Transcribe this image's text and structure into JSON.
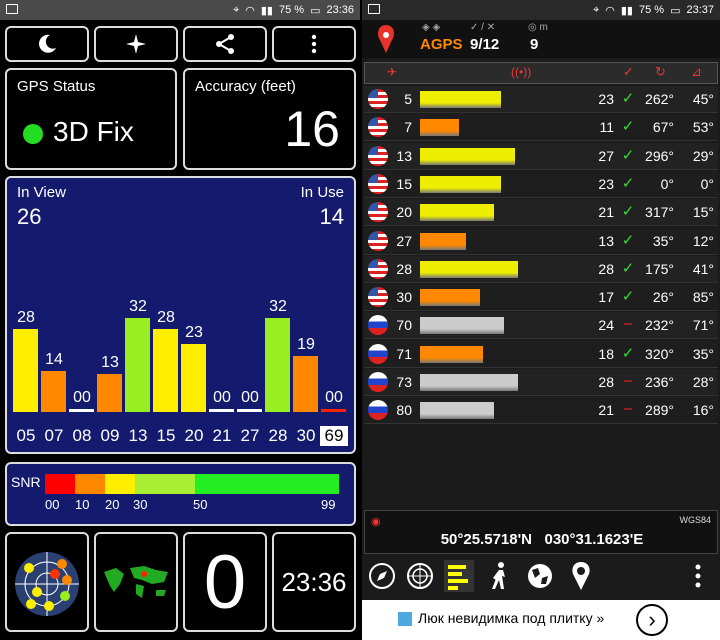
{
  "left_status": {
    "battery": "75 %",
    "time": "23:36"
  },
  "right_status": {
    "battery": "75 %",
    "time": "23:37"
  },
  "toolbar_left": {
    "night_icon": "moon-icon",
    "compass_icon": "compass-rose-icon",
    "share_icon": "share-icon",
    "more_icon": "more-vertical-icon"
  },
  "gps_status": {
    "label": "GPS Status",
    "value": "3D Fix",
    "color": "#22dd22"
  },
  "accuracy": {
    "label": "Accuracy (feet)",
    "value": "16"
  },
  "satellites": {
    "in_view_label": "In View",
    "in_view": "26",
    "in_use_label": "In Use",
    "in_use": "14",
    "bars": [
      {
        "prn": "05",
        "snr": "28",
        "value": 28,
        "color": "#ffee00"
      },
      {
        "prn": "07",
        "snr": "14",
        "value": 14,
        "color": "#ff8800"
      },
      {
        "prn": "08",
        "snr": "00",
        "value": 0,
        "color": "#ffffff"
      },
      {
        "prn": "09",
        "snr": "13",
        "value": 13,
        "color": "#ff8800"
      },
      {
        "prn": "13",
        "snr": "32",
        "value": 32,
        "color": "#99ee22"
      },
      {
        "prn": "15",
        "snr": "28",
        "value": 28,
        "color": "#ffee00"
      },
      {
        "prn": "20",
        "snr": "23",
        "value": 23,
        "color": "#ffee00"
      },
      {
        "prn": "21",
        "snr": "00",
        "value": 0,
        "color": "#ffffff"
      },
      {
        "prn": "27",
        "snr": "00",
        "value": 0,
        "color": "#ffffff"
      },
      {
        "prn": "28",
        "snr": "32",
        "value": 32,
        "color": "#99ee22"
      },
      {
        "prn": "30",
        "snr": "19",
        "value": 19,
        "color": "#ff8800"
      },
      {
        "prn": "69",
        "snr": "00",
        "value": 0,
        "color": "#ff2200",
        "selected": true
      }
    ],
    "max_value": 40
  },
  "snr_legend": {
    "label": "SNR",
    "ticks": [
      "00",
      "10",
      "20",
      "30",
      "50",
      "99"
    ],
    "colors": [
      "#ff0000",
      "#ff8800",
      "#ffee00",
      "#aaee33",
      "#22ee22"
    ]
  },
  "bottom": {
    "big_value": "0",
    "clock": "23:36"
  },
  "right_header": {
    "mode": "AGPS",
    "used_total": "9/12",
    "count": "9"
  },
  "table": {
    "rows": [
      {
        "prn": "5",
        "flag": "us",
        "snr": "23",
        "level": 23,
        "color": "#eeee00",
        "used": "✓",
        "az": "262°",
        "el": "45°"
      },
      {
        "prn": "7",
        "flag": "us",
        "snr": "11",
        "level": 11,
        "color": "#ff8800",
        "used": "✓",
        "az": "67°",
        "el": "53°"
      },
      {
        "prn": "13",
        "flag": "us",
        "snr": "27",
        "level": 27,
        "color": "#eeee00",
        "used": "✓",
        "az": "296°",
        "el": "29°"
      },
      {
        "prn": "15",
        "flag": "us",
        "snr": "23",
        "level": 23,
        "color": "#eeee00",
        "used": "✓",
        "az": "0°",
        "el": "0°"
      },
      {
        "prn": "20",
        "flag": "us",
        "snr": "21",
        "level": 21,
        "color": "#eeee00",
        "used": "✓",
        "az": "317°",
        "el": "15°"
      },
      {
        "prn": "27",
        "flag": "us",
        "snr": "13",
        "level": 13,
        "color": "#ff8800",
        "used": "✓",
        "az": "35°",
        "el": "12°"
      },
      {
        "prn": "28",
        "flag": "us",
        "snr": "28",
        "level": 28,
        "color": "#eeee00",
        "used": "✓",
        "az": "175°",
        "el": "41°"
      },
      {
        "prn": "30",
        "flag": "us",
        "snr": "17",
        "level": 17,
        "color": "#ff8800",
        "used": "✓",
        "az": "26°",
        "el": "85°"
      },
      {
        "prn": "70",
        "flag": "ru",
        "snr": "24",
        "level": 24,
        "color": "#cccccc",
        "used": "–",
        "az": "232°",
        "el": "71°"
      },
      {
        "prn": "71",
        "flag": "ru",
        "snr": "18",
        "level": 18,
        "color": "#ff8800",
        "used": "✓",
        "az": "320°",
        "el": "35°"
      },
      {
        "prn": "73",
        "flag": "ru",
        "snr": "28",
        "level": 28,
        "color": "#cccccc",
        "used": "–",
        "az": "236°",
        "el": "28°"
      },
      {
        "prn": "80",
        "flag": "ru",
        "snr": "21",
        "level": 21,
        "color": "#cccccc",
        "used": "–",
        "az": "289°",
        "el": "16°"
      }
    ],
    "max_level": 40
  },
  "coords": {
    "datum": "WGS84",
    "position": "50°25.5718'N   030°31.1623'E"
  },
  "ad": {
    "text": "Люк невидимка под плитку »"
  }
}
